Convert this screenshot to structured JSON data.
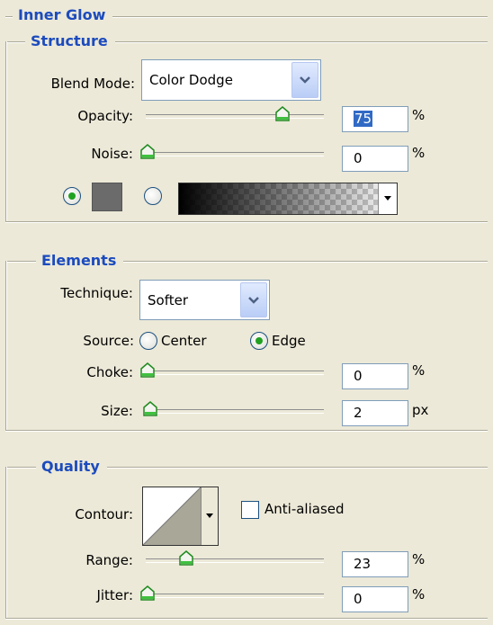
{
  "panel": {
    "title": "Inner Glow"
  },
  "structure": {
    "title": "Structure",
    "blend_mode": {
      "label": "Blend Mode:",
      "value": "Color Dodge"
    },
    "opacity": {
      "label": "Opacity:",
      "value": "75",
      "unit": "%",
      "level_percent": 75
    },
    "noise": {
      "label": "Noise:",
      "value": "0",
      "unit": "%",
      "level_percent": 0
    },
    "color_radio_selected": "color",
    "color_swatch": "#6B6B6B",
    "gradient": {
      "from": "#000000",
      "to": "transparent"
    }
  },
  "elements": {
    "title": "Elements",
    "technique": {
      "label": "Technique:",
      "value": "Softer"
    },
    "source": {
      "label": "Source:",
      "center_label": "Center",
      "edge_label": "Edge",
      "selected": "edge"
    },
    "choke": {
      "label": "Choke:",
      "value": "0",
      "unit": "%",
      "level_percent": 0
    },
    "size": {
      "label": "Size:",
      "value": "2",
      "unit": "px",
      "level_percent": 1
    }
  },
  "quality": {
    "title": "Quality",
    "contour": {
      "label": "Contour:"
    },
    "anti_aliased": {
      "label": "Anti-aliased",
      "checked": false
    },
    "range": {
      "label": "Range:",
      "value": "23",
      "unit": "%",
      "level_percent": 23
    },
    "jitter": {
      "label": "Jitter:",
      "value": "0",
      "unit": "%",
      "level_percent": 0
    }
  },
  "colors": {
    "title_blue": "#1C4BBE",
    "accent_green": "#21A121",
    "panel_bg": "#ECE9D8"
  },
  "icons": [
    "chevron-down-icon",
    "slider-thumb-icon",
    "contour-curve-icon",
    "dropdown-arrow-icon"
  ]
}
